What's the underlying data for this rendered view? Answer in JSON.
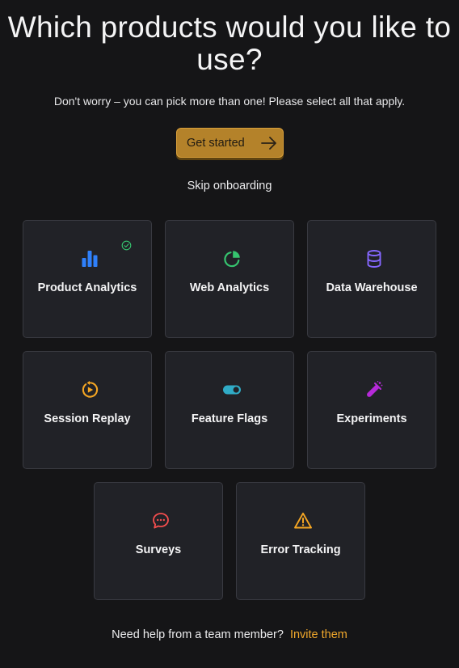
{
  "header": {
    "title": "Which products would you like to use?",
    "subtitle": "Don't worry – you can pick more than one! Please select all that apply."
  },
  "actions": {
    "get_started_label": "Get started",
    "skip_label": "Skip onboarding"
  },
  "products": [
    {
      "label": "Product Analytics",
      "icon": "bar-chart-icon",
      "color": "#2f80fa",
      "selected": true
    },
    {
      "label": "Web Analytics",
      "icon": "pie-chart-icon",
      "color": "#36c46f",
      "selected": false
    },
    {
      "label": "Data Warehouse",
      "icon": "database-icon",
      "color": "#8567ff",
      "selected": false
    },
    {
      "label": "Session Replay",
      "icon": "replay-icon",
      "color": "#f5a623",
      "selected": false
    },
    {
      "label": "Feature Flags",
      "icon": "toggle-icon",
      "color": "#30abc6",
      "selected": false
    },
    {
      "label": "Experiments",
      "icon": "flask-icon",
      "color": "#b62ad9",
      "selected": false
    },
    {
      "label": "Surveys",
      "icon": "chat-bubble-icon",
      "color": "#f54e4e",
      "selected": false
    },
    {
      "label": "Error Tracking",
      "icon": "warning-icon",
      "color": "#f5a623",
      "selected": false
    }
  ],
  "colors": {
    "background": "#151517",
    "card": "#212227",
    "accent": "#b4822a",
    "link": "#f1a82c",
    "selected_check": "#36c46f"
  },
  "footer": {
    "help_text": "Need help from a team member?",
    "invite_label": "Invite them"
  }
}
